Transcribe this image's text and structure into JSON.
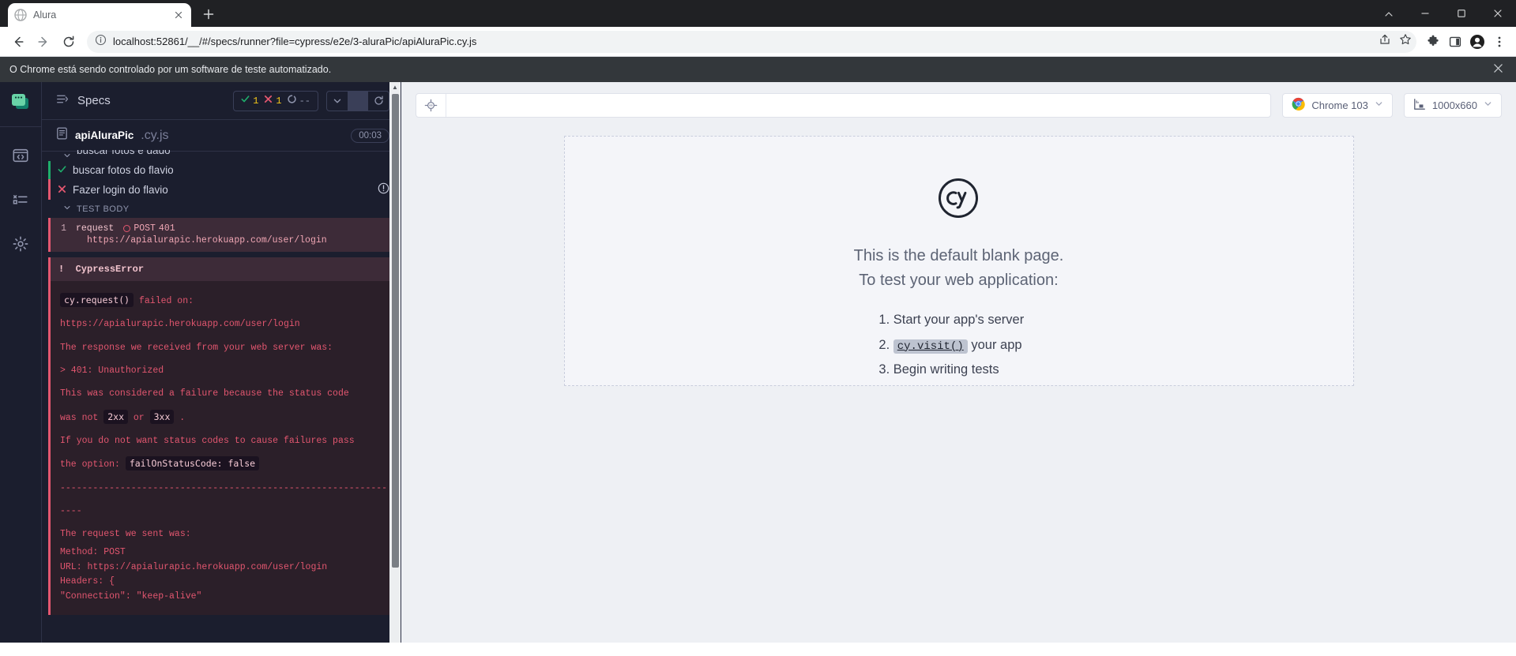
{
  "browser": {
    "tab": {
      "title": "Alura",
      "favicon_icon": "globe-icon",
      "close_icon": "close-icon"
    },
    "new_tab_icon": "plus-icon",
    "window_controls": {
      "minimize": "minimize-icon",
      "maximize": "maximize-icon",
      "close": "close-icon",
      "restore": "chevron-down-icon"
    },
    "nav": {
      "back_icon": "back-arrow-icon",
      "forward_icon": "forward-arrow-icon",
      "reload_icon": "reload-icon"
    },
    "omnibox": {
      "info_icon": "info-circle-icon",
      "url": "localhost:52861/__/#/specs/runner?file=cypress/e2e/3-aluraPic/apiAluraPic.cy.js",
      "share_icon": "share-icon",
      "bookmark_icon": "star-icon"
    },
    "toolbar_icons": [
      "extensions-puzzle-icon",
      "side-panel-icon",
      "profile-avatar-icon",
      "chrome-menu-icon"
    ],
    "automation_notice": {
      "text": "O Chrome está sendo controlado por um software de teste automatizado.",
      "close_icon": "close-icon"
    }
  },
  "rail": {
    "logo": "cypress-logo-icon",
    "items": [
      {
        "name": "specs",
        "icon": "code-window-icon"
      },
      {
        "name": "runs",
        "icon": "test-results-icon"
      },
      {
        "name": "settings",
        "icon": "gear-icon"
      }
    ]
  },
  "left_panel": {
    "header": {
      "menu_icon": "specs-list-icon",
      "title": "Specs",
      "stats": {
        "passed_icon": "check-icon",
        "passed": "1",
        "failed_icon": "x-icon",
        "failed": "1",
        "pending_icon": "pending-circle-icon",
        "pending": "--"
      },
      "controls": {
        "collapse_icon": "chevron-down-icon",
        "rerun_icon": "reload-icon"
      }
    },
    "spec": {
      "file_icon": "file-icon",
      "name": "apiAluraPic",
      "extension": ".cy.js",
      "duration": "00:03"
    },
    "suite": {
      "label": "buscar fotos e dado",
      "chevron_icon": "chevron-down-icon"
    },
    "tests": [
      {
        "label": "buscar fotos do flavio",
        "state": "passed",
        "icon": "check-icon"
      },
      {
        "label": "Fazer login do flavio",
        "state": "failed",
        "icon": "x-icon",
        "warning_icon": "alert-circle-icon"
      }
    ],
    "test_body_label": "TEST BODY",
    "command": {
      "number": "1",
      "name": "request",
      "status_icon": "pending-circle-icon",
      "method": "POST",
      "status_code": "401",
      "url": "https://apialurapic.herokuapp.com/user/login"
    },
    "error": {
      "badge_icon": "exclamation-icon",
      "title": "CypressError",
      "line_failed_code": "cy.request()",
      "line_failed_rest": " failed on:",
      "url": "https://apialurapic.herokuapp.com/user/login",
      "response_line": "The response we received from your web server was:",
      "status_line": "> 401: Unauthorized",
      "failure_reason_a": "This was considered a failure because the status code",
      "failure_reason_b": "was not ",
      "code_2xx": "2xx",
      "failure_reason_or": " or ",
      "code_3xx": "3xx",
      "failure_reason_end": " .",
      "option_line_a": "If you do not want status codes to cause failures pass",
      "option_line_b": "the option: ",
      "option_code": "failOnStatusCode: false",
      "divider": "------------------------------------------------------------",
      "divider2": "----",
      "request_line": "The request we sent was:",
      "method_line": "Method: POST",
      "url_line": "URL: https://apialurapic.herokuapp.com/user/login",
      "headers_line": "Headers: {",
      "headers_first": "\"Connection\": \"keep-alive\""
    }
  },
  "right_panel": {
    "selector_playground_icon": "crosshair-icon",
    "url_value": "",
    "url_placeholder": "",
    "browser_pill": {
      "icon": "chrome-logo-icon",
      "label": "Chrome 103",
      "chevron_icon": "chevron-down-icon"
    },
    "viewport_pill": {
      "icon": "ruler-icon",
      "label": "1000x660",
      "chevron_icon": "chevron-down-icon"
    },
    "aut": {
      "logo_icon": "cypress-cy-logo-icon",
      "heading_line1": "This is the default blank page.",
      "heading_line2": "To test your web application:",
      "steps": [
        {
          "before": "Start your app's server",
          "code": "",
          "after": ""
        },
        {
          "before": "",
          "code": "cy.visit()",
          "after": " your app"
        },
        {
          "before": "Begin writing tests",
          "code": "",
          "after": ""
        }
      ]
    }
  }
}
